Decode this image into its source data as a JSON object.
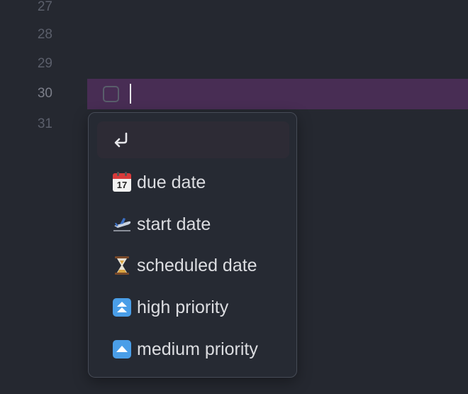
{
  "editor": {
    "line_numbers": [
      "27",
      "28",
      "29",
      "30",
      "31"
    ],
    "active_line": "30"
  },
  "suggestions": {
    "items": [
      {
        "label": "",
        "icon": "enter-arrow-icon",
        "selected": true
      },
      {
        "label": "due date",
        "icon": "calendar-icon",
        "badge": "17"
      },
      {
        "label": "start date",
        "icon": "airplane-departure-icon"
      },
      {
        "label": "scheduled date",
        "icon": "hourglass-icon"
      },
      {
        "label": "high priority",
        "icon": "double-up-arrow-icon"
      },
      {
        "label": "medium priority",
        "icon": "up-arrow-icon"
      }
    ]
  },
  "colors": {
    "background": "#252830",
    "active_line": "#482d54",
    "popup_border": "#464b56",
    "priority_blue": "#4a9ee8"
  }
}
